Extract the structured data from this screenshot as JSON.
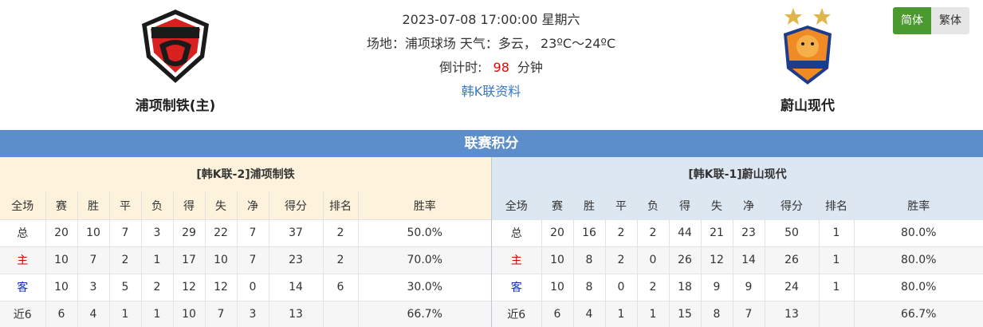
{
  "match": {
    "datetime": "2023-07-08 17:00:00 星期六",
    "venue_line": "场地：浦项球场 天气：多云， 23ºC～24ºC",
    "countdown_label": "倒计时:",
    "countdown_value": "98",
    "countdown_unit": "分钟",
    "league_link": "韩K联资料"
  },
  "home_team": {
    "name": "浦项制铁(主)",
    "logo_icon": "pohang-steelers-logo-icon"
  },
  "away_team": {
    "name": "蔚山现代",
    "logo_icon": "ulsan-hyundai-logo-icon"
  },
  "lang": {
    "simplified": "简体",
    "traditional": "繁体"
  },
  "section_title": "联赛积分",
  "columns": [
    "全场",
    "赛",
    "胜",
    "平",
    "负",
    "得",
    "失",
    "净",
    "得分",
    "排名",
    "胜率"
  ],
  "home_table": {
    "title": "[韩K联-2]浦项制铁",
    "rows": [
      [
        "总",
        "20",
        "10",
        "7",
        "3",
        "29",
        "22",
        "7",
        "37",
        "2",
        "50.0%"
      ],
      [
        "主",
        "10",
        "7",
        "2",
        "1",
        "17",
        "10",
        "7",
        "23",
        "2",
        "70.0%"
      ],
      [
        "客",
        "10",
        "3",
        "5",
        "2",
        "12",
        "12",
        "0",
        "14",
        "6",
        "30.0%"
      ],
      [
        "近6",
        "6",
        "4",
        "1",
        "1",
        "10",
        "7",
        "3",
        "13",
        "",
        "66.7%"
      ]
    ]
  },
  "away_table": {
    "title": "[韩K联-1]蔚山现代",
    "rows": [
      [
        "总",
        "20",
        "16",
        "2",
        "2",
        "44",
        "21",
        "23",
        "50",
        "1",
        "80.0%"
      ],
      [
        "主",
        "10",
        "8",
        "2",
        "0",
        "26",
        "12",
        "14",
        "26",
        "1",
        "80.0%"
      ],
      [
        "客",
        "10",
        "8",
        "0",
        "2",
        "18",
        "9",
        "9",
        "24",
        "1",
        "80.0%"
      ],
      [
        "近6",
        "6",
        "4",
        "1",
        "1",
        "15",
        "8",
        "7",
        "13",
        "",
        "66.7%"
      ]
    ]
  },
  "colors": {
    "accent_bar": "#5b8ecb",
    "lang_active": "#4a9a2f",
    "countdown": "#e00000",
    "home_label": "#d40000",
    "away_label": "#1030b0"
  }
}
